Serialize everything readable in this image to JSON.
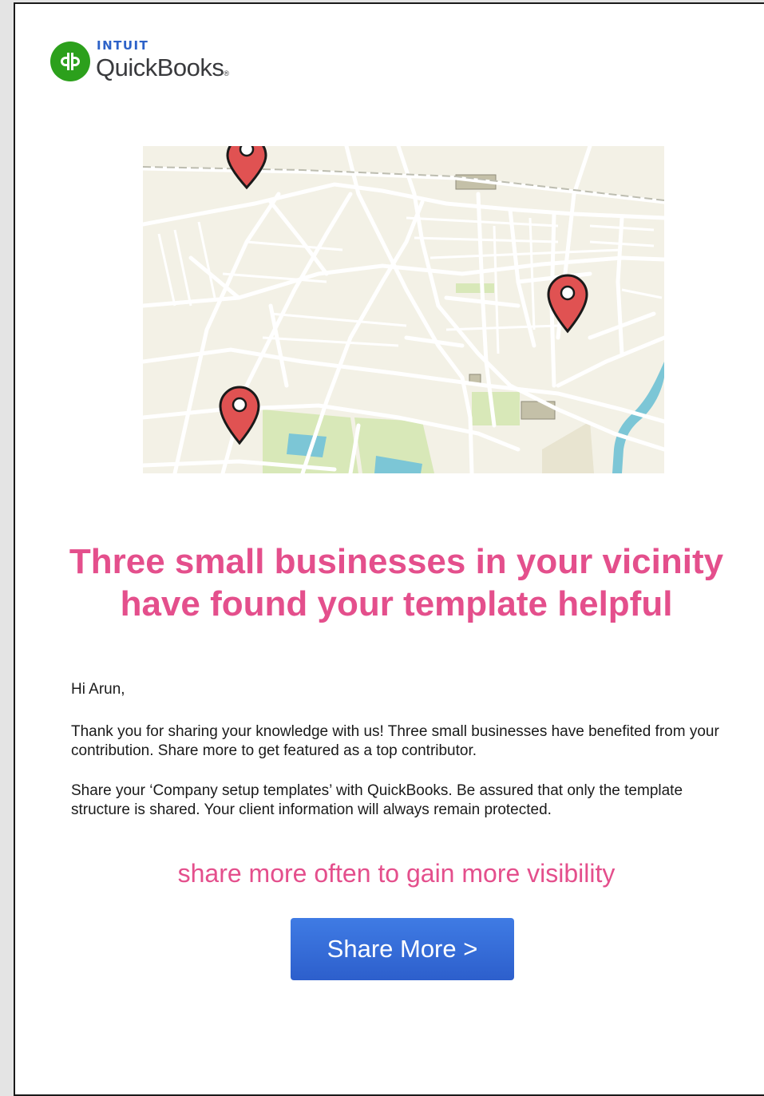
{
  "brand": {
    "intuit": "INTUIT",
    "name": "QuickBooks",
    "reg": "®",
    "mark_text": "qb",
    "green": "#2ca01c",
    "blue": "#2d62c8"
  },
  "map": {
    "icon": "map-with-location-pins",
    "pin_color": "#e05252",
    "pins": 3
  },
  "headline": {
    "line1": "Three small businesses in your vicinity",
    "line2": "have found your template helpful",
    "color": "#e44f8c"
  },
  "body": {
    "greeting": "Hi Arun,",
    "para1": "Thank you for sharing your knowledge with us! Three small businesses have benefited from your contribution. Share more to get featured as a top contributor.",
    "para2": "Share your ‘Company setup templates’ with QuickBooks. Be assured that only the template structure is shared. Your client information will always remain protected."
  },
  "tagline": "share more often to gain more visibility",
  "cta": {
    "label": "Share More >",
    "color": "#2d5fcc"
  }
}
